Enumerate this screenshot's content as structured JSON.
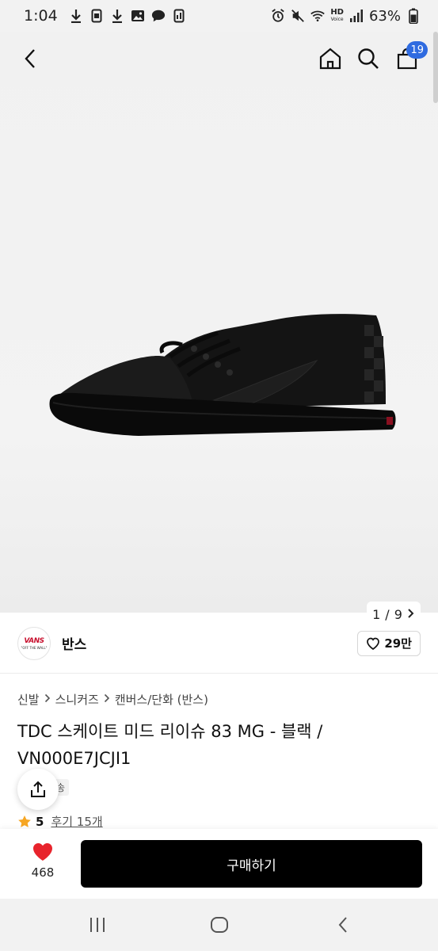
{
  "status_bar": {
    "time": "1:04",
    "network_label": "HD",
    "network_sublabel": "Voice",
    "battery_percent": "63%"
  },
  "header": {
    "cart_count": "19"
  },
  "gallery": {
    "current": "1",
    "separator": "/",
    "total": "9"
  },
  "brand": {
    "logo_text": "VANS",
    "logo_tagline": "\"OFF THE WALL\"",
    "name": "반스",
    "likes": "29만"
  },
  "product": {
    "breadcrumb": [
      "신발",
      "스니커즈",
      "캔버스/단화 (반스)"
    ],
    "title": "TDC 스케이트 미드 리이슈 83 MG - 블랙 / VN000E7JCJI1",
    "shipping_chip": "송",
    "rating": "5",
    "reviews": "후기 15개"
  },
  "action_bar": {
    "wishlist_count": "468",
    "buy_label": "구매하기"
  },
  "colors": {
    "accent_blue": "#2f6be0",
    "heart_red": "#e8242c",
    "star_orange": "#f6a623",
    "vans_red": "#c8102e"
  },
  "icons": {
    "back": "chevron-left-icon",
    "home": "home-icon",
    "search": "search-icon",
    "cart": "shopping-bag-icon",
    "share": "share-icon",
    "heart": "heart-icon",
    "star": "star-icon"
  }
}
